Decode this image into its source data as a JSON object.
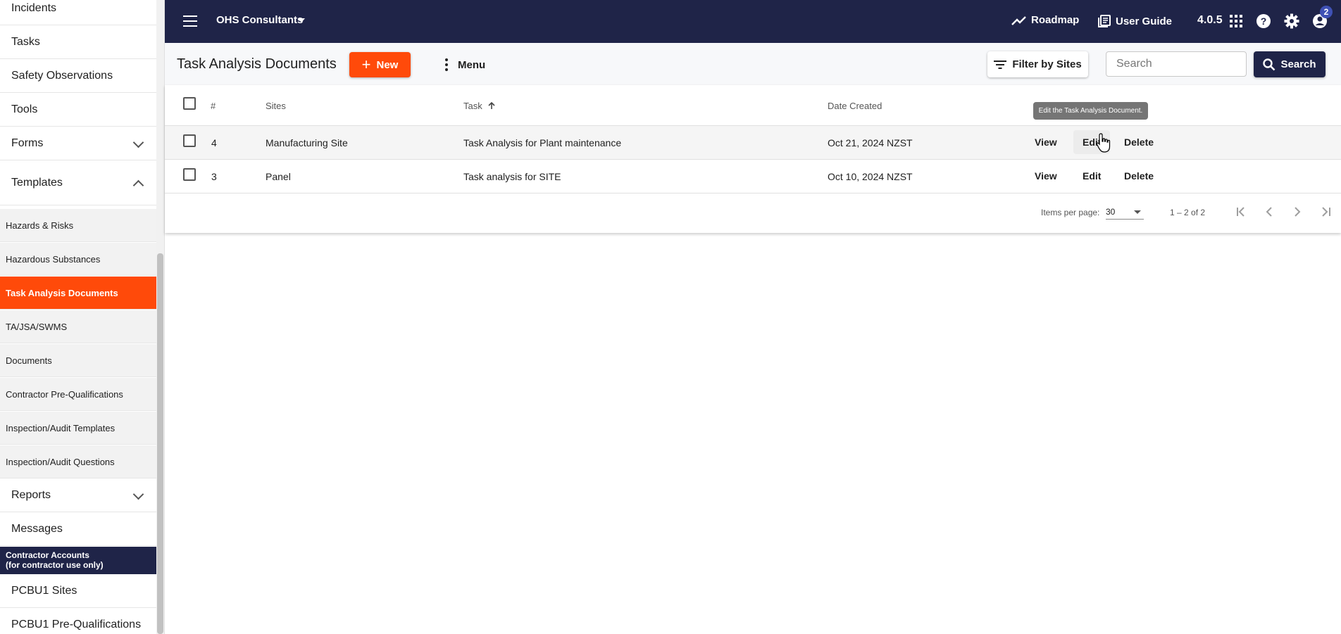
{
  "sidebar": {
    "items": [
      {
        "label": "Incidents"
      },
      {
        "label": "Tasks"
      },
      {
        "label": "Safety Observations"
      },
      {
        "label": "Tools"
      },
      {
        "label": "Forms"
      },
      {
        "label": "Templates"
      }
    ],
    "template_items": [
      {
        "label": "Hazards & Risks"
      },
      {
        "label": "Hazardous Substances"
      },
      {
        "label": "Task Analysis Documents",
        "active": true
      },
      {
        "label": "TA/JSA/SWMS"
      },
      {
        "label": "Documents"
      },
      {
        "label": "Contractor Pre-Qualifications"
      },
      {
        "label": "Inspection/Audit Templates"
      },
      {
        "label": "Inspection/Audit Questions"
      }
    ],
    "bottom_items": [
      {
        "label": "Reports"
      },
      {
        "label": "Messages"
      }
    ],
    "section_header_line1": "Contractor Accounts",
    "section_header_line2": "(for contractor use only)",
    "contractor_items": [
      {
        "label": "PCBU1 Sites"
      },
      {
        "label": "PCBU1 Pre-Qualifications"
      }
    ]
  },
  "topbar": {
    "org_name": "OHS Consultants",
    "roadmap_label": "Roadmap",
    "user_guide_label": "User Guide",
    "version": "4.0.5",
    "notification_count": "2"
  },
  "toolbar": {
    "title": "Task Analysis Documents",
    "new_label": "New",
    "menu_label": "Menu",
    "filter_label": "Filter by Sites",
    "search_placeholder": "Search",
    "search_label": "Search"
  },
  "table": {
    "headers": {
      "num": "#",
      "sites": "Sites",
      "task": "Task",
      "date": "Date Created"
    },
    "rows": [
      {
        "num": "4",
        "site": "Manufacturing Site",
        "task": "Task Analysis for Plant maintenance",
        "date": "Oct 21, 2024 NZST"
      },
      {
        "num": "3",
        "site": "Panel",
        "task": "Task analysis for SITE",
        "date": "Oct 10, 2024 NZST"
      }
    ],
    "actions": {
      "view": "View",
      "edit": "Edit",
      "delete": "Delete"
    },
    "tooltip": "Edit the Task Analysis Document."
  },
  "pager": {
    "items_label": "Items per page:",
    "page_size": "30",
    "range": "1 – 2 of 2"
  },
  "colors": {
    "navy": "#1f2448",
    "accent": "#ff4a0a",
    "badge": "#3f51b5"
  }
}
